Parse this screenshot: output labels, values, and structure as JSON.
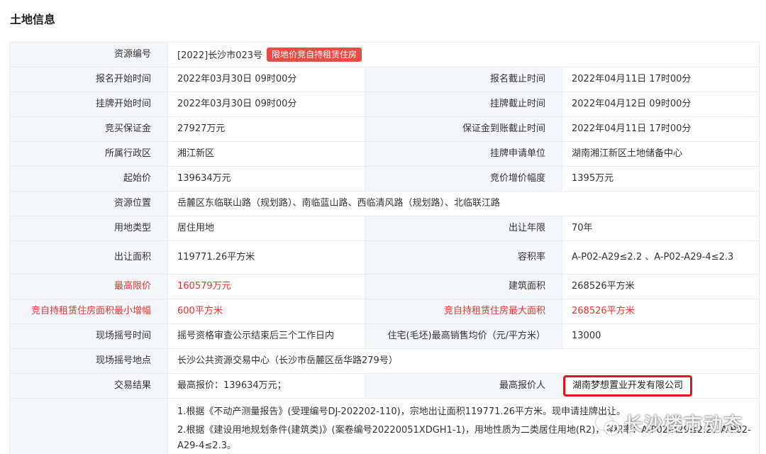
{
  "section_title": "土地信息",
  "resource_no": {
    "label": "资源编号",
    "value": "[2022]长沙市023号",
    "tag": "限地价竞自持租赁住房"
  },
  "rows": [
    {
      "l1": "报名开始时间",
      "v1": "2022年03月30日 09时00分",
      "l2": "报名截止时间",
      "v2": "2022年04月11日 17时00分"
    },
    {
      "l1": "挂牌开始时间",
      "v1": "2022年03月30日 09时00分",
      "l2": "挂牌截止时间",
      "v2": "2022年04月12日 09时00分"
    },
    {
      "l1": "竞买保证金",
      "v1": "27927万元",
      "l2": "保证金到账截止时间",
      "v2": "2022年04月11日 17时00分"
    },
    {
      "l1": "所属行政区",
      "v1": "湘江新区",
      "l2": "挂牌申请单位",
      "v2": "湖南湘江新区土地储备中心"
    },
    {
      "l1": "起始价",
      "v1": "139634万元",
      "l2": "竞价增价幅度",
      "v2": "1395万元"
    }
  ],
  "location": {
    "label": "资源位置",
    "value": "岳麓区东临联山路（规划路）、南临蓝山路、西临清风路（规划路）、北临联江路"
  },
  "rows2": [
    {
      "l1": "用地类型",
      "v1": "居住用地",
      "l2": "出让年限",
      "v2": "70年"
    },
    {
      "l1": "出让面积",
      "v1": "119771.26平方米",
      "l2": "容积率",
      "v2": "A-P02-A29≤2.2 、A-P02-A29-4≤2.3"
    }
  ],
  "rows_highlight": [
    {
      "l1": "最高限价",
      "v1": "160579万元",
      "l2": "建筑面积",
      "v2": "268526平方米"
    },
    {
      "l1": "竞自持租赁住房面积最小增幅",
      "v1": "600平方米",
      "l2": "竞自持租赁住房最大面积",
      "v2": "268526平方米"
    }
  ],
  "draw_time": {
    "l1": "现场摇号时间",
    "v1": "摇号资格审查公示结束后三个工作日内",
    "l2": "住宅(毛坯)最高销售均价（元/平方米）",
    "v2": "13000"
  },
  "draw_place": {
    "label": "现场摇号地点",
    "value": "长沙公共资源交易中心（长沙市岳麓区岳华路279号）"
  },
  "result": {
    "label": "交易结果",
    "v1": "最高报价：139634万元；",
    "l2": "最高报价人",
    "v2": "湖南梦想置业开发有限公司"
  },
  "notes": [
    "1.根据《不动产测量报告》(受理编号DJ-202202-110)，宗地出让面积119771.26平方米。现申请挂牌出让。",
    "2.根据《建设用地规划条件(建筑类)》(案卷编号20220051XDGH1-1)，用地性质为二类居住用地(R2)，容积率：A-P02-A29≤2.2、A-P02-A29-4≤2.3。"
  ],
  "watermark": "长沙楼市动态",
  "colors": {
    "tag_bg": "#e94b45",
    "highlight_text": "#e8322b",
    "result_box": "#e4141b",
    "label_bg": "#f3f6fa"
  }
}
